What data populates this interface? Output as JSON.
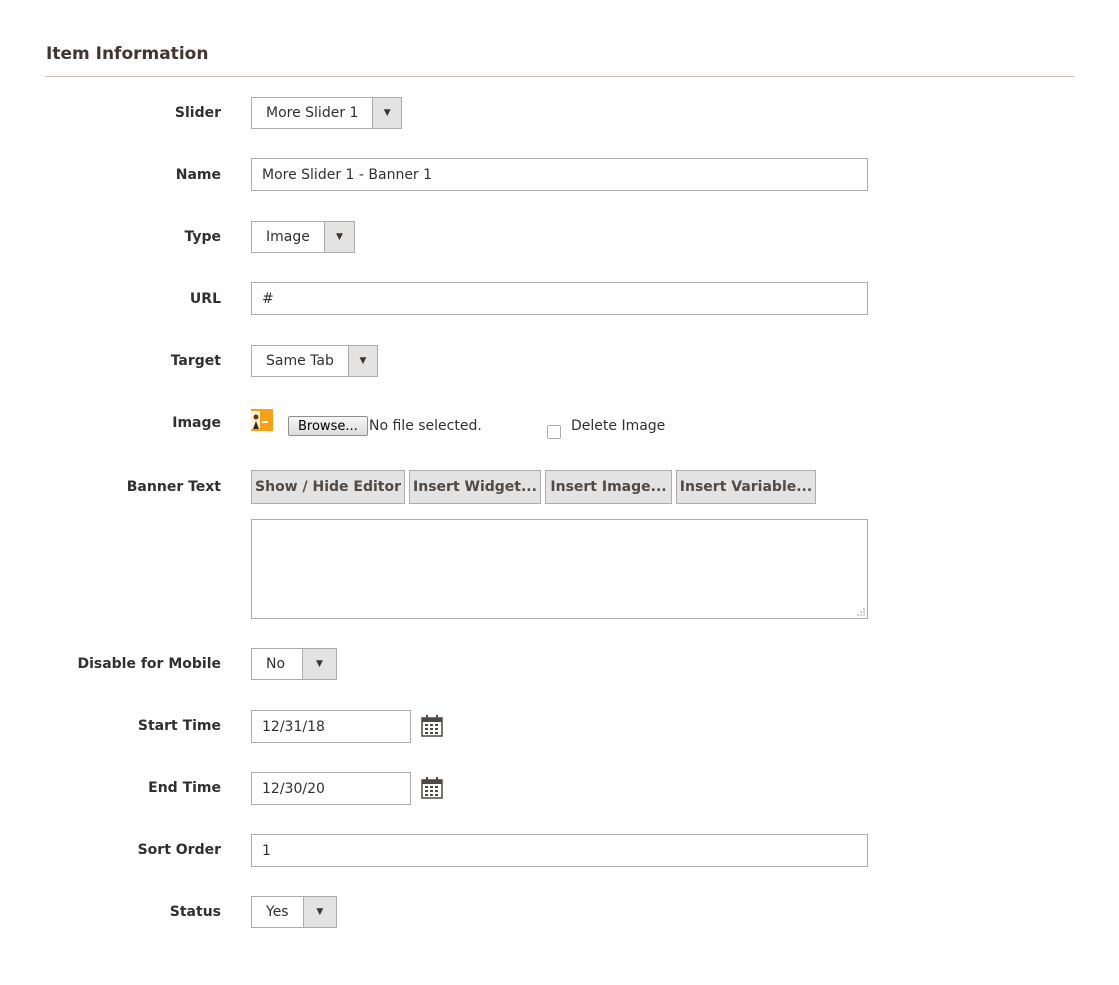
{
  "section": {
    "title": "Item Information"
  },
  "fields": {
    "slider": {
      "label": "Slider",
      "value": "More Slider 1"
    },
    "name": {
      "label": "Name",
      "value": "More Slider 1 - Banner 1"
    },
    "type": {
      "label": "Type",
      "value": "Image"
    },
    "url": {
      "label": "URL",
      "value": "#"
    },
    "target": {
      "label": "Target",
      "value": "Same Tab"
    },
    "image": {
      "label": "Image",
      "browse_label": "Browse...",
      "file_status": "No file selected.",
      "delete_label": "Delete Image",
      "delete_checked": false
    },
    "banner_text": {
      "label": "Banner Text",
      "buttons": [
        "Show / Hide Editor",
        "Insert Widget...",
        "Insert Image...",
        "Insert Variable..."
      ],
      "value": ""
    },
    "disable_mobile": {
      "label": "Disable for Mobile",
      "value": "No"
    },
    "start_time": {
      "label": "Start Time",
      "value": "12/31/18"
    },
    "end_time": {
      "label": "End Time",
      "value": "12/30/20"
    },
    "sort_order": {
      "label": "Sort Order",
      "value": "1"
    },
    "status": {
      "label": "Status",
      "value": "Yes"
    }
  },
  "icons": {
    "dropdown": "chevron-down-icon",
    "calendar": "calendar-icon",
    "thumbnail": "image-thumbnail-icon"
  },
  "colors": {
    "border": "#adadad",
    "button_bg": "#e3e3e3",
    "title": "#41362f",
    "rule": "#cac3b4",
    "thumb": "#f7a11a"
  }
}
